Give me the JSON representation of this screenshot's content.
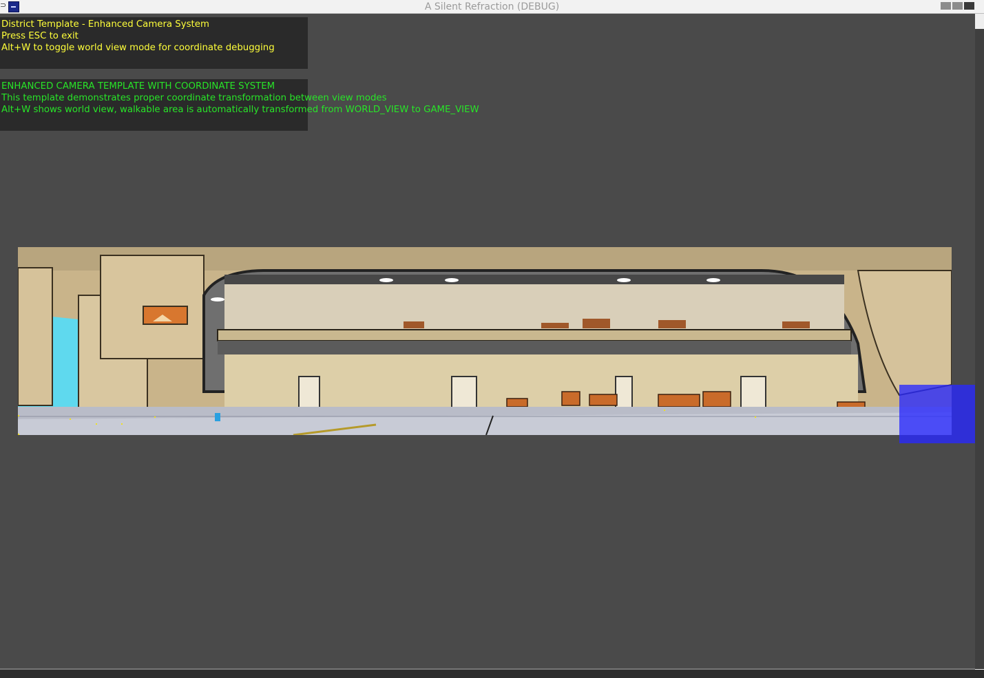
{
  "window": {
    "title": "A Silent Refraction (DEBUG)"
  },
  "info_panel": {
    "lines": [
      "District Template - Enhanced Camera System",
      "Press ESC to exit",
      "Alt+W to toggle world view mode for coordinate debugging"
    ],
    "color": "#ffff3a"
  },
  "debug_panel": {
    "lines": [
      "ENHANCED CAMERA TEMPLATE WITH COORDINATE SYSTEM",
      "This template demonstrates proper coordinate transformation between view modes",
      "Alt+W shows world view, walkable area is automatically transformed from WORLD_VIEW to GAME_VIEW"
    ],
    "color": "#28e428"
  },
  "scene": {
    "name": "hangar-district-background",
    "walkable_marker_color": "#2aa0e0",
    "overlay_color": "#2828ff"
  }
}
